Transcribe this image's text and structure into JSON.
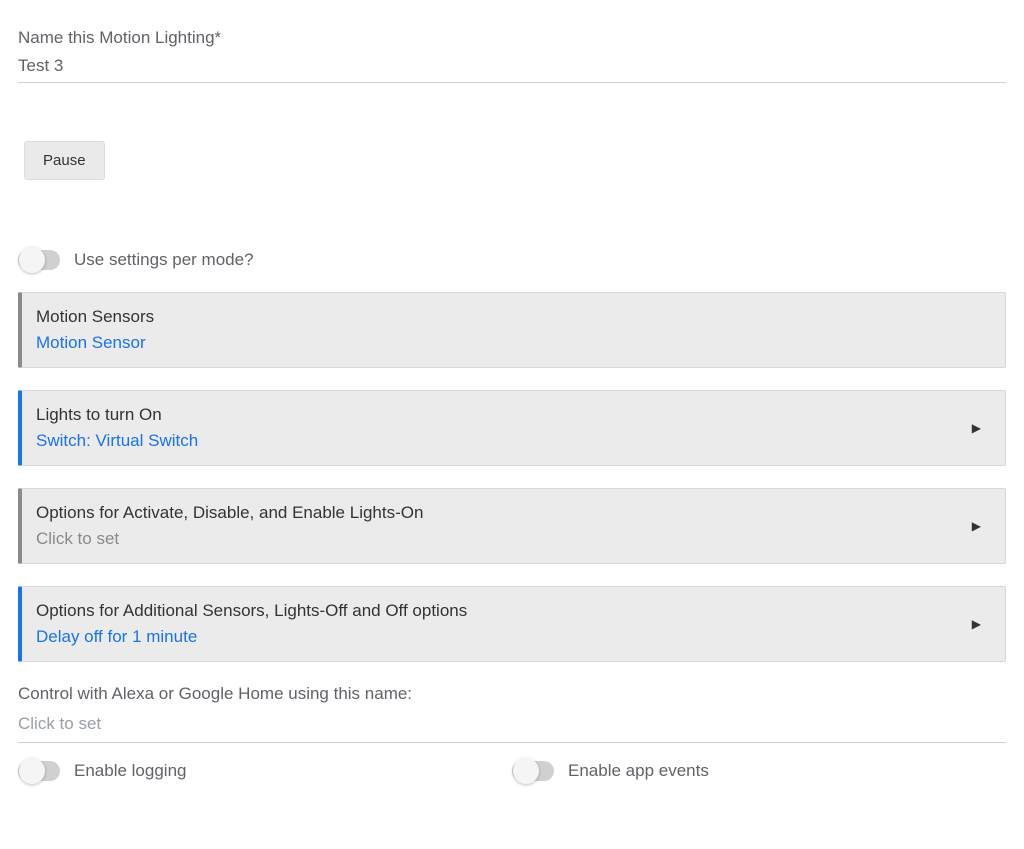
{
  "name_field": {
    "label": "Name this Motion Lighting*",
    "value": "Test 3"
  },
  "pause_button": {
    "label": "Pause"
  },
  "toggle_per_mode": {
    "label": "Use settings per mode?"
  },
  "panels": {
    "motion_sensors": {
      "title": "Motion Sensors",
      "subtitle": "Motion Sensor"
    },
    "lights_on": {
      "title": "Lights to turn On",
      "subtitle": "Switch: Virtual Switch"
    },
    "options_activate": {
      "title": "Options for Activate, Disable, and Enable Lights-On",
      "subtitle": "Click to set"
    },
    "options_off": {
      "title": "Options for Additional Sensors, Lights-Off and Off options",
      "subtitle": "Delay off for 1 minute"
    }
  },
  "control_with": {
    "label": "Control with Alexa or Google Home using this name:",
    "placeholder": "Click to set"
  },
  "bottom": {
    "logging": "Enable logging",
    "app_events": "Enable app events"
  }
}
